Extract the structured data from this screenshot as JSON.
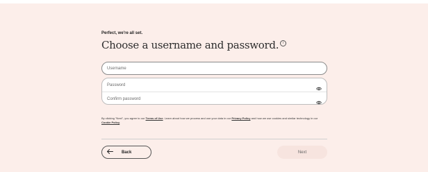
{
  "header": {
    "eyebrow": "Perfect, we're all set.",
    "title": "Choose a username and password.",
    "info_icon": "info-icon"
  },
  "form": {
    "username": {
      "placeholder": "Username",
      "value": ""
    },
    "password": {
      "placeholder": "Password",
      "value": "",
      "icon": "eye-icon"
    },
    "confirm_password": {
      "placeholder": "Confirm password",
      "value": "",
      "icon": "eye-icon"
    }
  },
  "legal": {
    "part1": "By clicking \"Next\", you agree to our ",
    "terms": "Terms of Use",
    "part2": ". Learn about how we process and use your data in our ",
    "privacy": "Privacy Policy",
    "part3": " and how we use cookies and similar technology in our ",
    "cookie": "Cookie Policy",
    "part4": "."
  },
  "nav": {
    "back_label": "Back",
    "back_icon": "arrow-left-icon",
    "next_label": "Next"
  },
  "colors": {
    "background": "#fceeea",
    "next_button": "#f7e4df"
  }
}
